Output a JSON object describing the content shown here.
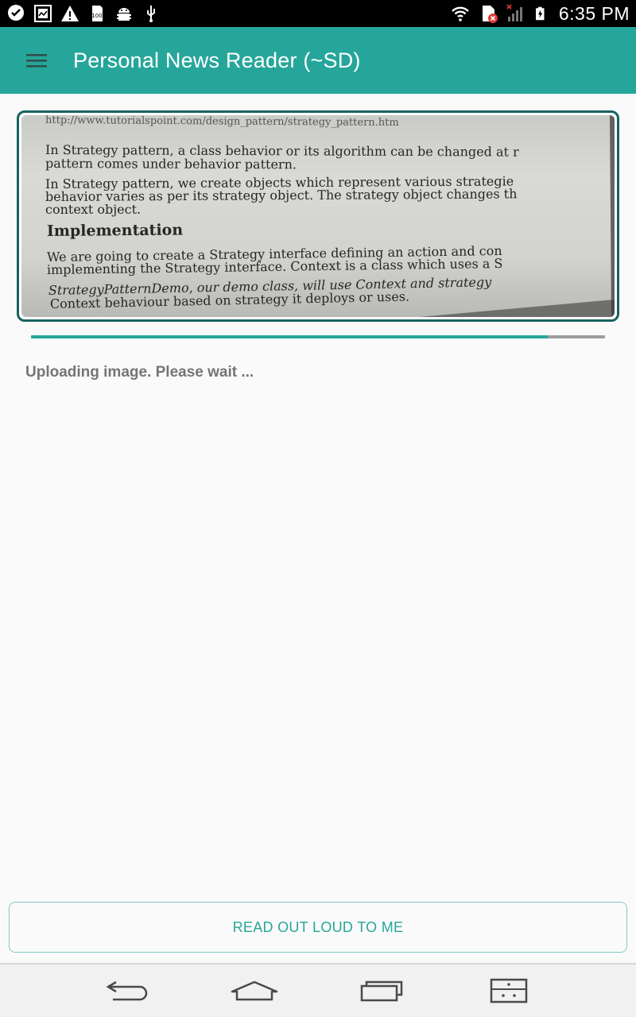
{
  "status_bar": {
    "time": "6:35 PM",
    "left_icons": [
      "hangouts-icon",
      "gallery-icon",
      "warning-icon",
      "sd-card-icon",
      "android-debug-icon",
      "usb-icon"
    ],
    "right_icons": [
      "wifi-icon",
      "sim-error-icon",
      "signal-icon",
      "battery-charging-icon"
    ]
  },
  "app_bar": {
    "title": "Personal News Reader (~SD)",
    "menu_icon": "hamburger-menu-icon",
    "background_color": "#26a69a"
  },
  "image_preview": {
    "lines": [
      "http://www.tutorialspoint.com/design_pattern/strategy_pattern.htm",
      "In Strategy pattern, a class behavior or its algorithm can be changed at r",
      "pattern comes under behavior pattern.",
      "In Strategy pattern, we create objects which represent various strategie",
      "behavior varies as per its strategy object. The strategy object changes th",
      "context object.",
      "Implementation",
      "We are going to create a Strategy interface defining an action and con",
      "implementing the Strategy interface. Context is a class which uses a S",
      "StrategyPatternDemo, our demo class, will use Context and strategy",
      "Context behaviour based on strategy it deploys or uses."
    ]
  },
  "upload": {
    "progress_percent": 90,
    "status_text": "Uploading image. Please wait ..."
  },
  "actions": {
    "read_out_loud_label": "READ OUT LOUD TO ME"
  },
  "nav_bar": {
    "buttons": [
      "back-icon",
      "home-icon",
      "recent-apps-icon",
      "sim-menu-icon"
    ]
  },
  "colors": {
    "accent": "#26a69a",
    "frame_border": "#16635e",
    "status_text": "#757575"
  }
}
